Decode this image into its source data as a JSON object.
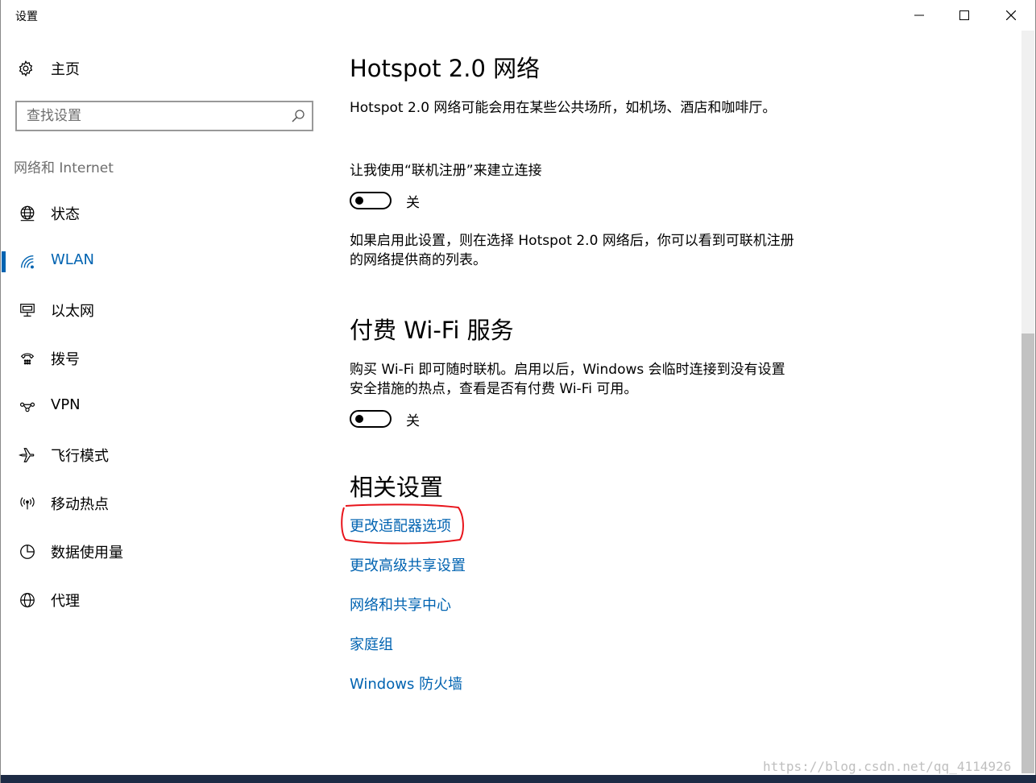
{
  "window": {
    "title": "设置",
    "minimize_icon": "minimize-icon",
    "maximize_icon": "maximize-icon",
    "close_icon": "close-icon"
  },
  "sidebar": {
    "home_label": "主页",
    "search_placeholder": "查找设置",
    "section_label": "网络和 Internet",
    "items": [
      {
        "label": "状态",
        "icon": "globe-status-icon"
      },
      {
        "label": "WLAN",
        "icon": "wifi-icon",
        "active": true
      },
      {
        "label": "以太网",
        "icon": "ethernet-icon"
      },
      {
        "label": "拨号",
        "icon": "dialup-icon"
      },
      {
        "label": "VPN",
        "icon": "vpn-icon"
      },
      {
        "label": "飞行模式",
        "icon": "airplane-icon"
      },
      {
        "label": "移动热点",
        "icon": "hotspot-icon"
      },
      {
        "label": "数据使用量",
        "icon": "data-usage-icon"
      },
      {
        "label": "代理",
        "icon": "globe-icon"
      }
    ]
  },
  "content": {
    "hotspot": {
      "heading": "Hotspot 2.0 网络",
      "description": "Hotspot 2.0 网络可能会用在某些公共场所，如机场、酒店和咖啡厅。",
      "option_label": "让我使用“联机注册”来建立连接",
      "toggle_state": "关",
      "note": "如果启用此设置，则在选择 Hotspot 2.0 网络后，你可以看到可联机注册的网络提供商的列表。"
    },
    "paid_wifi": {
      "heading": "付费 Wi-Fi 服务",
      "description": "购买 Wi-Fi 即可随时联机。启用以后，Windows 会临时连接到没有设置安全措施的热点，查看是否有付费 Wi-Fi 可用。",
      "toggle_state": "关"
    },
    "related": {
      "heading": "相关设置",
      "links": [
        "更改适配器选项",
        "更改高级共享设置",
        "网络和共享中心",
        "家庭组",
        "Windows 防火墙"
      ]
    }
  },
  "colors": {
    "accent": "#0063b1",
    "annotation": "#e8141b"
  },
  "watermark": "https://blog.csdn.net/qq_4114926"
}
